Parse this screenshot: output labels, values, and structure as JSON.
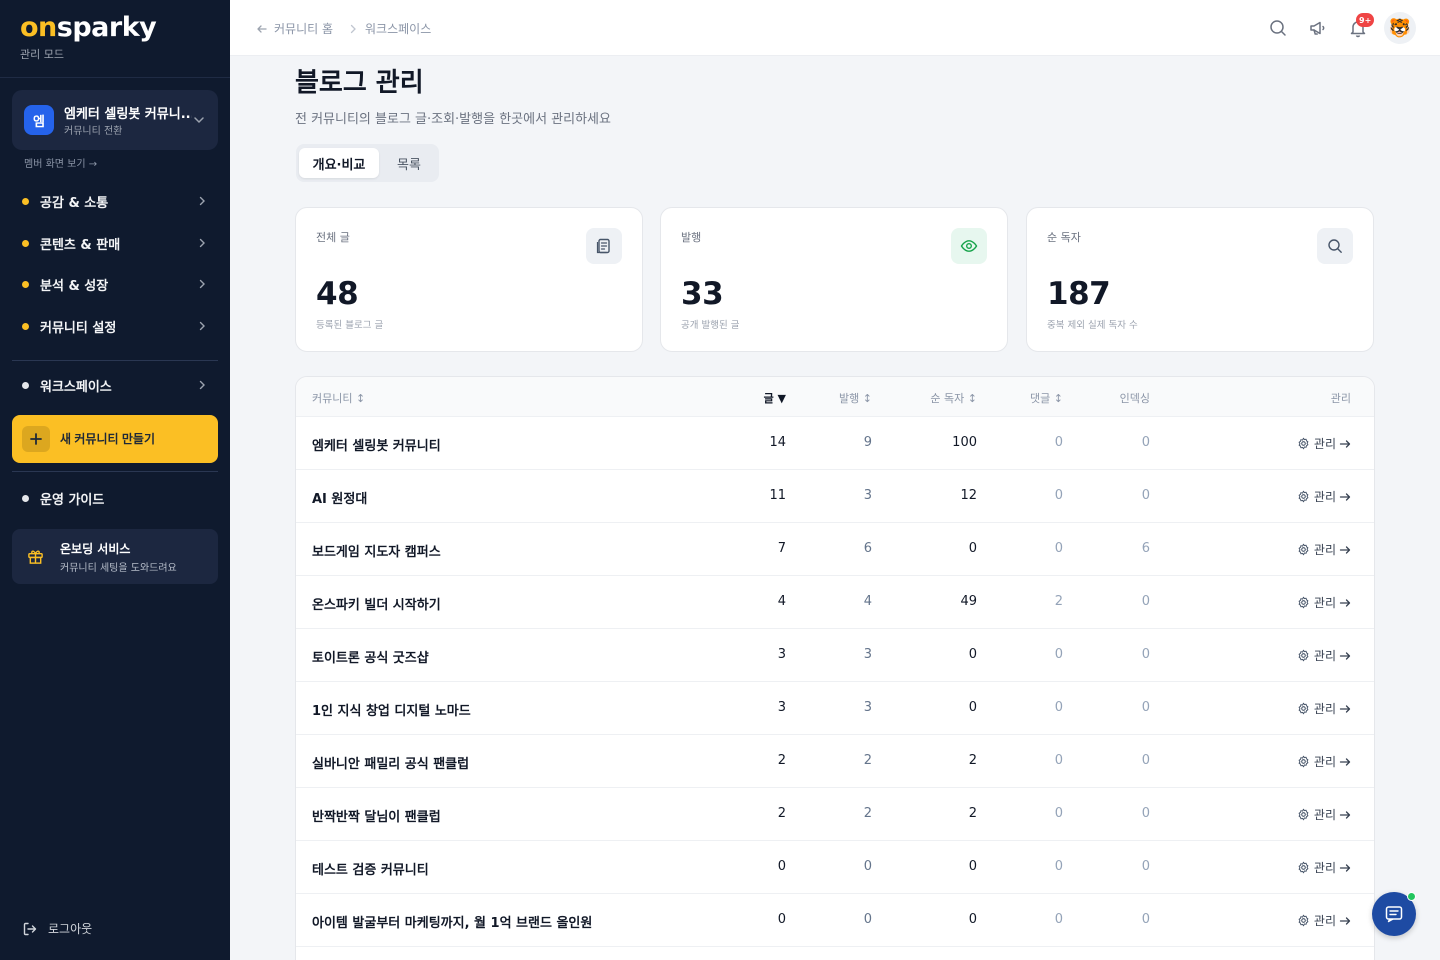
{
  "sidebar": {
    "logo_prefix": "on",
    "logo_suffix": "sparky",
    "mode_label": "관리 모드",
    "community": {
      "badge": "엠",
      "name": "엠케터 셀링봇 커뮤니...",
      "subtitle": "커뮤니티 전환"
    },
    "member_view": "멤버 화면 보기 →",
    "nav_items": [
      {
        "label": "공감 & 소통",
        "dot_color": "#fbbf24"
      },
      {
        "label": "콘텐츠 & 판매",
        "dot_color": "#fbbf24"
      },
      {
        "label": "분석 & 성장",
        "dot_color": "#fbbf24"
      },
      {
        "label": "커뮤니티 설정",
        "dot_color": "#fbbf24"
      },
      {
        "label": "워크스페이스",
        "dot_color": "#e5e7eb"
      }
    ],
    "create_button": "새 커뮤니티 만들기",
    "guide": {
      "label": "운영 가이드",
      "dot_color": "#e5e7eb"
    },
    "onboarding": {
      "title": "온보딩 서비스",
      "subtitle": "커뮤니티 세팅을 도와드려요"
    },
    "logout": "로그아웃"
  },
  "header": {
    "breadcrumbs": [
      "커뮤니티 홈",
      "워크스페이스"
    ],
    "notification_count": "9+",
    "avatar_emoji": "🐯"
  },
  "page": {
    "title": "블로그 관리",
    "description": "전 커뮤니티의 블로그 글·조회·발행을 한곳에서 관리하세요",
    "tabs": [
      {
        "label": "개요·비교",
        "active": true
      },
      {
        "label": "목록",
        "active": false
      }
    ]
  },
  "stats": [
    {
      "label": "전체 글",
      "value": "48",
      "note": "등록된 블로그 글",
      "icon": "document-icon"
    },
    {
      "label": "발행",
      "value": "33",
      "note": "공개 발행된 글",
      "icon": "eye-icon"
    },
    {
      "label": "순 독자",
      "value": "187",
      "note": "중복 제외 실제 독자 수",
      "icon": "search-icon"
    }
  ],
  "table": {
    "headers": {
      "community": "커뮤니티 ↕",
      "posts": "글 ▼",
      "published": "발행 ↕",
      "readers": "순 독자 ↕",
      "comments": "댓글 ↕",
      "insight": "인덱싱",
      "manage": "관리"
    },
    "manage_label": "관리",
    "rows": [
      {
        "name": "엠케터 셀링봇 커뮤니티",
        "posts": "14",
        "published": "9",
        "readers": "100",
        "comments": "0",
        "insight": "0"
      },
      {
        "name": "AI 원정대",
        "posts": "11",
        "published": "3",
        "readers": "12",
        "comments": "0",
        "insight": "0"
      },
      {
        "name": "보드게임 지도자 캠퍼스",
        "posts": "7",
        "published": "6",
        "readers": "0",
        "comments": "0",
        "insight": "6"
      },
      {
        "name": "온스파키 빌더 시작하기",
        "posts": "4",
        "published": "4",
        "readers": "49",
        "comments": "2",
        "insight": "0"
      },
      {
        "name": "토이트론 공식 굿즈샵",
        "posts": "3",
        "published": "3",
        "readers": "0",
        "comments": "0",
        "insight": "0"
      },
      {
        "name": "1인 지식 창업 디지털 노마드",
        "posts": "3",
        "published": "3",
        "readers": "0",
        "comments": "0",
        "insight": "0"
      },
      {
        "name": "실바니안 패밀리 공식 팬클럽",
        "posts": "2",
        "published": "2",
        "readers": "2",
        "comments": "0",
        "insight": "0"
      },
      {
        "name": "반짝반짝 달님이 팬클럽",
        "posts": "2",
        "published": "2",
        "readers": "2",
        "comments": "0",
        "insight": "0"
      },
      {
        "name": "테스트 검증 커뮤니티",
        "posts": "0",
        "published": "0",
        "readers": "0",
        "comments": "0",
        "insight": "0"
      },
      {
        "name": "아이템 발굴부터 마케팅까지, 월 1억 브랜드 올인원",
        "posts": "0",
        "published": "0",
        "readers": "0",
        "comments": "0",
        "insight": "0"
      }
    ]
  },
  "colors": {
    "accent": "#fbbf24",
    "sidebar_bg": "#0f1a2e",
    "chat_button": "#1e4ba3",
    "notify_badge": "#ef4444"
  }
}
